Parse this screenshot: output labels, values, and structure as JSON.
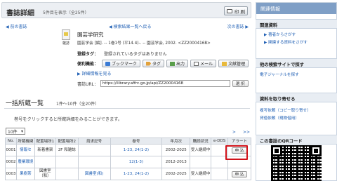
{
  "header": {
    "title": "書誌詳細",
    "count": "5件目を表示（全25件）",
    "print_label": "印 刷"
  },
  "nav": {
    "prev": "◀ 前の書誌",
    "back": "◀ 検索結果一覧へ戻る",
    "next": "次の書誌 ▶"
  },
  "record": {
    "type_label": "雑誌",
    "title": "園芸学研究",
    "detail": "園芸学会 [編]. -- 1巻1号 (平14.4)-. -- 園芸学会, 2002. <ZZ20004168>",
    "tags_label": "登録タグ：",
    "tags_value": "登録されているタグはありません",
    "tools_label": "便利機能：",
    "tools": [
      "ブックマーク",
      "タグ",
      "出力",
      "メール",
      "文献管理"
    ],
    "more_detail": "▶ 詳細情報を見る",
    "url_label": "書誌URL：",
    "url_value": "https://ilibrary.affrc.go.jp/api/ZZ20004168",
    "select_label": "選 択"
  },
  "holdings": {
    "title": "一括所蔵一覧",
    "subtitle": "1件〜10件（全20件）",
    "note": "巻号をクリックすると所蔵詳細をみることができます。",
    "per_page": "10件",
    "pager": [
      ">",
      ">>"
    ],
    "columns": [
      "No.",
      "所蔵機関",
      "配置場所1",
      "配置場所2",
      "請求記号",
      "巻号",
      "年月次",
      "購読状況",
      "e-DDS",
      "アラート"
    ],
    "rows": [
      {
        "no": "0001",
        "org": "情報セ",
        "loc1": "新着書架",
        "loc2": "2F 和雑誌",
        "call": "",
        "vol": "1-23, 24(1-2)",
        "year": "2002-2025",
        "status": "受入継続中",
        "edds": "",
        "alert": "申 込"
      },
      {
        "no": "0002",
        "org": "農業環境",
        "loc1": "",
        "loc2": "",
        "call": "",
        "vol": "12(1-3)",
        "year": "2012-2013",
        "status": "",
        "edds": "",
        "alert": ""
      },
      {
        "no": "0003",
        "org": "果樹茶",
        "loc1": "図書室（和）",
        "loc2": "",
        "call": "図書室(和)",
        "vol": "1-23, 24(1-2)",
        "year": "2002-2025",
        "status": "受入継続中",
        "edds": "",
        "alert": "申 込"
      }
    ]
  },
  "side": {
    "header": "関連情報",
    "related_title": "関連資料",
    "related_links": [
      "▶ 著者からさがす",
      "▶ 関連する資料をさがす"
    ],
    "other_site_title": "他の検索サイトで探す",
    "other_site_link": "電子ジャーナルを探す",
    "request_title": "資料を取り寄せる",
    "request_links": [
      "複写依頼（コピー取り寄せ）",
      "貸借依頼（現物借用）"
    ],
    "qr_title": "この書誌のQRコード"
  }
}
